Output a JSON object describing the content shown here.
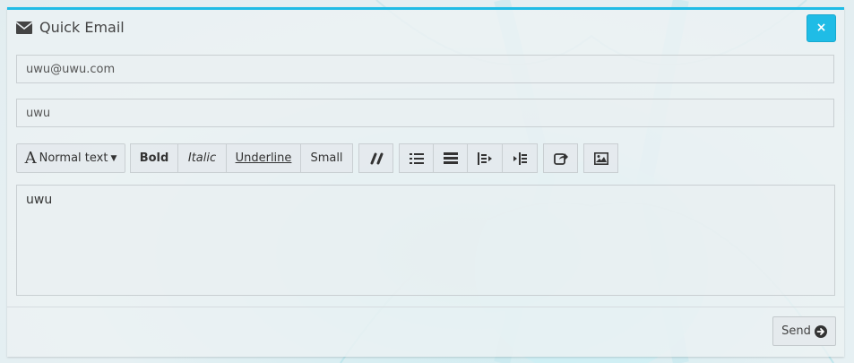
{
  "header": {
    "title": "Quick Email",
    "icon": "envelope-icon",
    "close_label": "×"
  },
  "email_to": {
    "value": "uwu@uwu.com"
  },
  "subject": {
    "value": "uwu"
  },
  "toolbar": {
    "font_size_label": "Normal text",
    "bold_label": "Bold",
    "italic_label": "Italic",
    "underline_label": "Underline",
    "small_label": "Small"
  },
  "editor": {
    "content": "uwu"
  },
  "footer": {
    "send_label": "Send"
  },
  "colors": {
    "accent": "#1fbce6"
  }
}
